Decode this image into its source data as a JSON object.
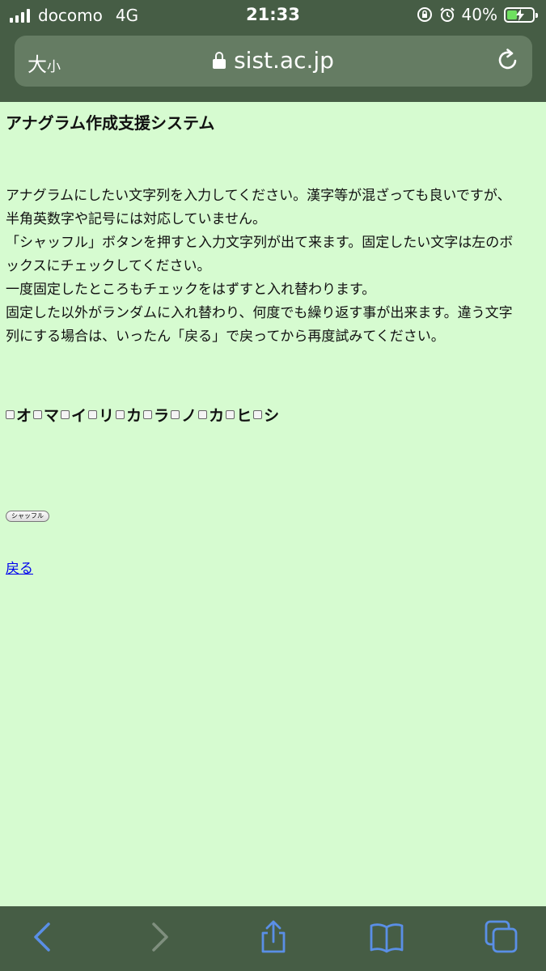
{
  "status_bar": {
    "carrier": "docomo",
    "network": "4G",
    "time": "21:33",
    "battery_percent": "40%",
    "battery_level": 0.4
  },
  "browser": {
    "text_size_big": "大",
    "text_size_small": "小",
    "url": "sist.ac.jp"
  },
  "page": {
    "title": "アナグラム作成支援システム",
    "description_lines": [
      "アナグラムにしたい文字列を入力してください。漢字等が混ざっても良いですが、",
      "半角英数字や記号には対応していません。",
      "「シャッフル」ボタンを押すと入力文字列が出て来ます。固定したい文字は左のボ",
      "ックスにチェックしてください。",
      "一度固定したところもチェックをはずすと入れ替わります。",
      "固定した以外がランダムに入れ替わり、何度でも繰り返す事が出来ます。違う文字",
      "列にする場合は、いったん「戻る」で戻ってから再度試みてください。"
    ],
    "characters": [
      "オ",
      "マ",
      "イ",
      "リ",
      "カ",
      "ラ",
      "ノ",
      "カ",
      "ヒ",
      "シ"
    ],
    "shuffle_label": "シャッフル",
    "back_label": "戻る"
  },
  "colors": {
    "chrome": "#465d45",
    "address_bar": "#657c63",
    "page_background": "#d6fbd0",
    "toolbar_icon": "#5a8fe6",
    "link": "#0000ee"
  }
}
